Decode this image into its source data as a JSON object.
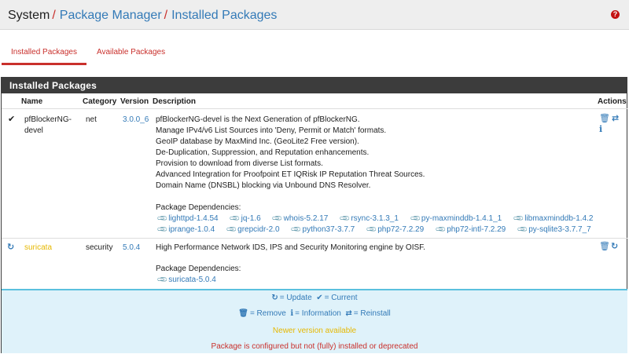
{
  "breadcrumb": {
    "root": "System",
    "separator": "/",
    "items": [
      "Package Manager",
      "Installed Packages"
    ]
  },
  "help_icon": "question-circle-icon",
  "tabs": [
    {
      "label": "Installed Packages",
      "active": true
    },
    {
      "label": "Available Packages",
      "active": false
    }
  ],
  "panel": {
    "title": "Installed Packages",
    "columns": [
      "Name",
      "Category",
      "Version",
      "Description",
      "Actions"
    ]
  },
  "packages": [
    {
      "status": "current",
      "status_icon": "check-icon",
      "name_line1": "pfBlockerNG-",
      "name_line2": "devel",
      "category": "net",
      "version": "3.0.0_6",
      "description": [
        "pfBlockerNG-devel is the Next Generation of pfBlockerNG.",
        "Manage IPv4/v6 List Sources into 'Deny, Permit or Match' formats.",
        "GeoIP database by MaxMind Inc. (GeoLite2 Free version).",
        "De-Duplication, Suppression, and Reputation enhancements.",
        "Provision to download from diverse List formats.",
        "Advanced Integration for Proofpoint ET IQRisk IP Reputation Threat Sources.",
        "Domain Name (DNSBL) blocking via Unbound DNS Resolver."
      ],
      "deps_label": "Package Dependencies:",
      "deps_row1": [
        "lighttpd-1.4.54",
        "jq-1.6",
        "whois-5.2.17",
        "rsync-3.1.3_1",
        "py-maxminddb-1.4.1_1",
        "libmaxminddb-1.4.2"
      ],
      "deps_row2": [
        "iprange-1.0.4",
        "grepcidr-2.0",
        "python37-3.7.7",
        "php72-7.2.29",
        "php72-intl-7.2.29",
        "py-sqlite3-3.7.7_7"
      ],
      "actions": [
        "trash-icon",
        "reinstall-icon",
        "info-icon"
      ]
    },
    {
      "status": "update",
      "status_icon": "refresh-icon",
      "name": "suricata",
      "category": "security",
      "version": "5.0.4",
      "description": [
        "High Performance Network IDS, IPS and Security Monitoring engine by OISF."
      ],
      "deps_label": "Package Dependencies:",
      "deps": [
        "suricata-5.0.4"
      ],
      "actions": [
        "trash-icon",
        "refresh-icon"
      ]
    }
  ],
  "legend": {
    "update": "= Update",
    "current": "= Current",
    "remove": "= Remove",
    "information": "= Information",
    "reinstall": "= Reinstall",
    "newer": "Newer version available",
    "broken": "Package is configured but not (fully) installed or deprecated"
  },
  "colors": {
    "link": "#337ab7",
    "accent_red": "#c9302c",
    "warning_yellow": "#e6b800",
    "panel_header": "#3c3c3c",
    "legend_bg": "#dff2fa"
  }
}
